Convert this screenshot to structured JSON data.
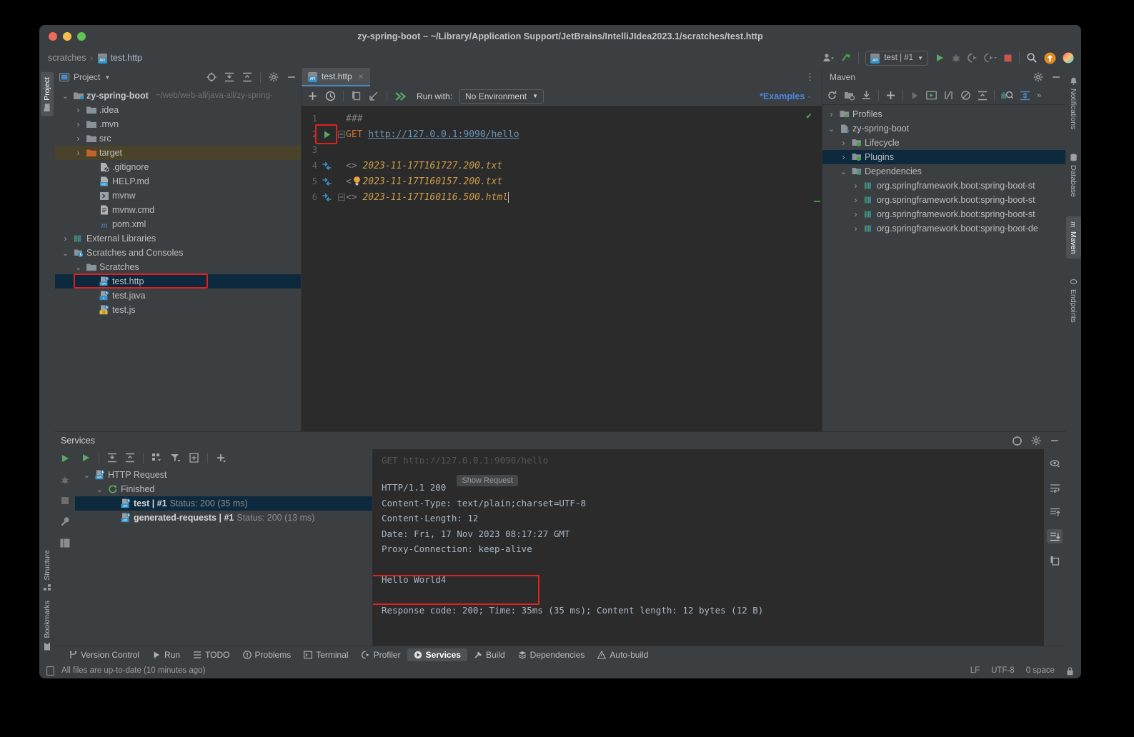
{
  "window": {
    "title": "zy-spring-boot – ~/Library/Application Support/JetBrains/IntelliJIdea2023.1/scratches/test.http"
  },
  "breadcrumb": {
    "root": "scratches",
    "separator": "›",
    "file": "test.http"
  },
  "top_toolbar": {
    "run_config": "test | #1",
    "icons": [
      "user-account-icon",
      "updates-arrow-icon",
      "run-icon",
      "debug-icon",
      "run-coverage-icon",
      "profiler-icon",
      "stop-icon",
      "search-everywhere-icon",
      "notification-icon",
      "ai-assistant-icon"
    ]
  },
  "left_tool_tabs": [
    {
      "label": "Project",
      "icon": "folder-icon",
      "active": true
    },
    {
      "label": "Structure",
      "icon": "structure-icon",
      "active": false
    },
    {
      "label": "Bookmarks",
      "icon": "bookmark-icon",
      "active": false
    }
  ],
  "right_tool_tabs": [
    {
      "label": "Notifications",
      "icon": "bell-icon",
      "active": false
    },
    {
      "label": "Database",
      "icon": "database-icon",
      "active": false
    },
    {
      "label": "Maven",
      "icon": "maven-m-icon",
      "active": true
    },
    {
      "label": "Endpoints",
      "icon": "endpoints-icon",
      "active": false
    }
  ],
  "project_panel": {
    "title": "Project",
    "toolbar_icons": [
      "select-opened-file-icon",
      "expand-all-icon",
      "collapse-all-icon",
      "settings-gear-icon",
      "hide-icon"
    ],
    "tree": [
      {
        "label": "zy-spring-boot",
        "path": "~/web/web-all/java-all/zy-spring-",
        "depth": 0,
        "arrow": "down",
        "icon": "module-folder-icon",
        "bold": true
      },
      {
        "label": ".idea",
        "depth": 1,
        "arrow": "right",
        "icon": "folder-icon"
      },
      {
        "label": ".mvn",
        "depth": 1,
        "arrow": "right",
        "icon": "folder-icon"
      },
      {
        "label": "src",
        "depth": 1,
        "arrow": "right",
        "icon": "folder-icon"
      },
      {
        "label": "target",
        "depth": 1,
        "arrow": "right",
        "icon": "folder-orange-icon",
        "highlight": true
      },
      {
        "label": ".gitignore",
        "depth": 2,
        "arrow": "none",
        "icon": "gitignore-icon"
      },
      {
        "label": "HELP.md",
        "depth": 2,
        "arrow": "none",
        "icon": "markdown-icon"
      },
      {
        "label": "mvnw",
        "depth": 2,
        "arrow": "none",
        "icon": "script-icon"
      },
      {
        "label": "mvnw.cmd",
        "depth": 2,
        "arrow": "none",
        "icon": "cmd-icon"
      },
      {
        "label": "pom.xml",
        "depth": 2,
        "arrow": "none",
        "icon": "maven-m-icon"
      },
      {
        "label": "External Libraries",
        "depth": 0,
        "arrow": "right",
        "icon": "library-icon"
      },
      {
        "label": "Scratches and Consoles",
        "depth": 0,
        "arrow": "down",
        "icon": "scratches-icon"
      },
      {
        "label": "Scratches",
        "depth": 1,
        "arrow": "down",
        "icon": "folder-icon"
      },
      {
        "label": "test.http",
        "depth": 2,
        "arrow": "none",
        "icon": "http-api-icon",
        "selected": true,
        "boxed": true
      },
      {
        "label": "test.java",
        "depth": 2,
        "arrow": "none",
        "icon": "java-api-icon"
      },
      {
        "label": "test.js",
        "depth": 2,
        "arrow": "none",
        "icon": "js-api-icon"
      }
    ]
  },
  "editor": {
    "tab": {
      "label": "test.http",
      "icon": "http-api-icon",
      "close": "×"
    },
    "toolbar": {
      "icons": [
        "add-request-icon",
        "history-clock-icon",
        "convert-icon",
        "import-icon",
        "run-all-icon"
      ],
      "run_with_label": "Run with:",
      "environment": "No Environment",
      "examples_label": "*Examples"
    },
    "lines": [
      {
        "num": "1",
        "gutter": "none",
        "fold": "none",
        "tokens": [
          {
            "t": "###",
            "c": "c-comment"
          }
        ]
      },
      {
        "num": "2",
        "gutter": "run-green-triangle",
        "fold": "fold-minus",
        "boxed": true,
        "tokens": [
          {
            "t": "GET ",
            "c": "c-method"
          },
          {
            "t": "http://127.0.0.1:9090/hello",
            "c": "c-url"
          }
        ]
      },
      {
        "num": "3",
        "gutter": "none",
        "fold": "none",
        "tokens": []
      },
      {
        "num": "4",
        "gutter": "compare-icon",
        "fold": "none",
        "tokens": [
          {
            "t": "<> ",
            "c": "c-sep"
          },
          {
            "t": "2023-11-17T161727.200.txt",
            "c": "c-file"
          }
        ]
      },
      {
        "num": "5",
        "gutter": "compare-icon",
        "fold": "none",
        "tokens": [
          {
            "t": "<",
            "c": "c-sep"
          },
          {
            "t": "  ",
            "c": "c-sep"
          },
          {
            "t": "2023-11-17T160157.200.txt",
            "c": "c-file"
          }
        ]
      },
      {
        "num": "6",
        "gutter": "compare-icon",
        "fold": "fold-minus",
        "tokens": [
          {
            "t": "<> ",
            "c": "c-sep"
          },
          {
            "t": "2023-11-17T160116.500.html",
            "c": "c-file"
          }
        ]
      }
    ],
    "inspection_ok": "✔"
  },
  "maven_panel": {
    "title": "Maven",
    "toolbar_icons": [
      "reload-icon",
      "add-maven-project-icon",
      "download-sources-icon",
      "add-icon",
      "run-icon",
      "execute-goal-icon",
      "toggle-skip-tests-icon",
      "toggle-offline-icon",
      "collapse-all-icon",
      "show-dependencies-icon",
      "expand-icon",
      "more-icon"
    ],
    "header_icons": [
      "settings-gear-icon",
      "hide-icon"
    ],
    "tree": [
      {
        "label": "Profiles",
        "depth": 0,
        "arrow": "right",
        "icon": "profiles-icon"
      },
      {
        "label": "zy-spring-boot",
        "depth": 0,
        "arrow": "down",
        "icon": "maven-project-icon"
      },
      {
        "label": "Lifecycle",
        "depth": 1,
        "arrow": "right",
        "icon": "lifecycle-folder-icon"
      },
      {
        "label": "Plugins",
        "depth": 1,
        "arrow": "right",
        "icon": "plugins-folder-icon",
        "selected": true
      },
      {
        "label": "Dependencies",
        "depth": 1,
        "arrow": "down",
        "icon": "dependencies-folder-icon"
      },
      {
        "label": "org.springframework.boot:spring-boot-st",
        "depth": 2,
        "arrow": "right",
        "icon": "library-icon"
      },
      {
        "label": "org.springframework.boot:spring-boot-st",
        "depth": 2,
        "arrow": "right",
        "icon": "library-icon"
      },
      {
        "label": "org.springframework.boot:spring-boot-st",
        "depth": 2,
        "arrow": "right",
        "icon": "library-icon"
      },
      {
        "label": "org.springframework.boot:spring-boot-de",
        "depth": 2,
        "arrow": "right",
        "icon": "library-icon"
      }
    ]
  },
  "services": {
    "title": "Services",
    "header_icons": [
      "help-icon",
      "settings-gear-icon",
      "hide-icon"
    ],
    "gutter_icons": [
      "run-icon",
      "debug-icon",
      "stop-icon",
      "wrench-icon",
      "layout-icon"
    ],
    "toolbar_icons": [
      "run-icon",
      "expand-all-icon",
      "collapse-all-icon",
      "group-icon",
      "filter-icon",
      "add-frame-icon",
      "add-icon"
    ],
    "tree": [
      {
        "label": "HTTP Request",
        "depth": 0,
        "arrow": "down",
        "icon": "http-api-icon"
      },
      {
        "label": "Finished",
        "depth": 1,
        "arrow": "down",
        "icon": "rerun-green-icon"
      },
      {
        "name": "test  |  #1",
        "status": "Status: 200 (35 ms)",
        "depth": 2,
        "arrow": "none",
        "icon": "http-api-icon",
        "selected": true
      },
      {
        "name": "generated-requests | #1",
        "status": "Status: 200 (13 ms)",
        "depth": 2,
        "arrow": "none",
        "icon": "http-api-icon"
      }
    ],
    "response": {
      "clipped_top_line": "GET http://127.0.0.1:9090/hello",
      "show_request_label": "Show Request",
      "lines": [
        "HTTP/1.1 200",
        "Content-Type: text/plain;charset=UTF-8",
        "Content-Length: 12",
        "Date: Fri, 17 Nov 2023 08:17:27 GMT",
        "Proxy-Connection: keep-alive",
        "",
        "Hello World4",
        "",
        "Response code: 200; Time: 35ms (35 ms); Content length: 12 bytes (12 B)"
      ],
      "highlighted_body": "Hello World4",
      "side_icons": [
        "preview-icon",
        "soft-wrap-icon",
        "scroll-to-top-icon",
        "scroll-to-end-icon",
        "copy-icon"
      ]
    }
  },
  "bottom_tabs": [
    {
      "label": "Version Control",
      "icon": "branch-icon",
      "active": false
    },
    {
      "label": "Run",
      "icon": "run-icon",
      "active": false
    },
    {
      "label": "TODO",
      "icon": "todo-list-icon",
      "active": false
    },
    {
      "label": "Problems",
      "icon": "problems-icon",
      "active": false
    },
    {
      "label": "Terminal",
      "icon": "terminal-icon",
      "active": false
    },
    {
      "label": "Profiler",
      "icon": "profiler-icon",
      "active": false
    },
    {
      "label": "Services",
      "icon": "services-icon",
      "active": true
    },
    {
      "label": "Build",
      "icon": "build-hammer-icon",
      "active": false
    },
    {
      "label": "Dependencies",
      "icon": "dependencies-icon",
      "active": false
    },
    {
      "label": "Auto-build",
      "icon": "warning-icon",
      "active": false
    }
  ],
  "status_bar": {
    "message": "All files are up-to-date (10 minutes ago)",
    "line_separator": "LF",
    "encoding": "UTF-8",
    "indent": "0 space",
    "lock_icon": "lock-icon"
  },
  "colors": {
    "accent_blue": "#4a88c7",
    "selection": "#0d293e",
    "highlight_red": "#e02020",
    "editor_bg": "#2b2b2b",
    "panel_bg": "#3c3f41",
    "run_green": "#62b543",
    "link_blue": "#6897bb",
    "string_orange": "#cc9b4a",
    "keyword_orange": "#cc7832"
  }
}
